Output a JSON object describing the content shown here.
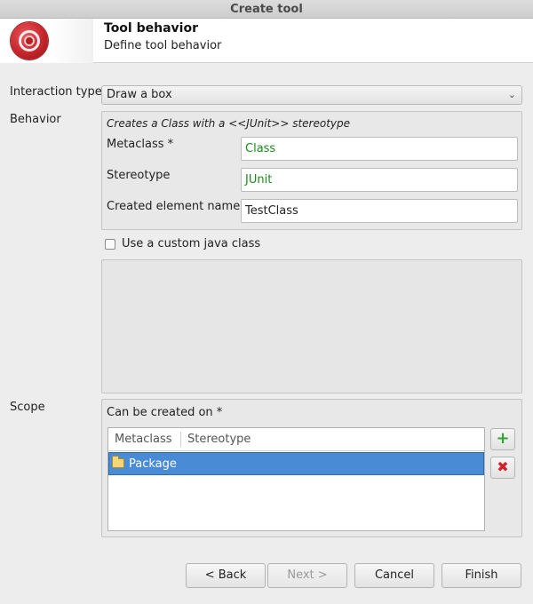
{
  "window": {
    "title": "Create tool"
  },
  "header": {
    "title": "Tool behavior",
    "subtitle": "Define tool behavior"
  },
  "interaction": {
    "label": "Interaction type",
    "value": "Draw a box"
  },
  "behavior": {
    "label": "Behavior",
    "description": "Creates a Class with a <<JUnit>> stereotype",
    "metaclass_label": "Metaclass *",
    "metaclass_value": "Class",
    "stereotype_label": "Stereotype",
    "stereotype_value": "JUnit",
    "element_name_label": "Created element name *",
    "element_name_value": "TestClass",
    "custom_class_label": "Use a custom java class"
  },
  "scope": {
    "label": "Scope",
    "group_label": "Can be created on *",
    "columns": [
      "Metaclass",
      "Stereotype"
    ],
    "rows": [
      {
        "metaclass": "Package",
        "stereotype": ""
      }
    ]
  },
  "buttons": {
    "back": "< Back",
    "next": "Next >",
    "cancel": "Cancel",
    "finish": "Finish"
  },
  "colors": {
    "selection": "#4a8bd6",
    "value_green": "#1a8a1a",
    "brand_red": "#c6262c"
  },
  "icons": {
    "add": "plus-icon",
    "remove": "delete-icon",
    "folder": "folder-icon",
    "logo": "app-logo-icon"
  }
}
